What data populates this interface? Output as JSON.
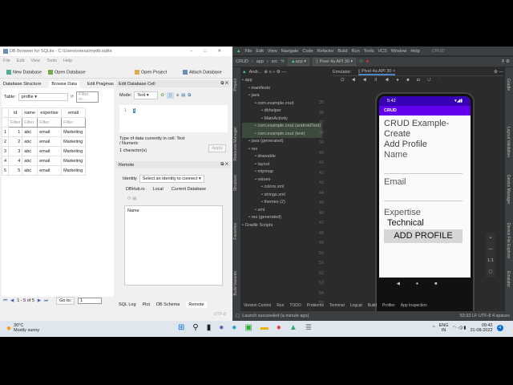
{
  "dbbrowser": {
    "title": "DB Browser for SQLite - C:\\Users\\neesa\\mydb.sqlite",
    "menu": [
      "File",
      "Edit",
      "View",
      "Tools",
      "Help"
    ],
    "toolbar": {
      "new_db": "New Database",
      "open_db": "Open Database",
      "open_project": "Open Project",
      "attach_db": "Attach Database"
    },
    "tabs": [
      "Database Structure",
      "Browse Data",
      "Edit Pragmas"
    ],
    "table_label": "Table:",
    "table_value": "profile",
    "filter_placeholder": "Filter in...",
    "columns": [
      "id",
      "name",
      "expertise",
      "email"
    ],
    "filter": "Filter",
    "rows": [
      {
        "n": "1",
        "id": "1",
        "name": "abc",
        "expertise": "email",
        "email": "Marketing"
      },
      {
        "n": "2",
        "id": "2",
        "name": "abc",
        "expertise": "email",
        "email": "Marketing"
      },
      {
        "n": "3",
        "id": "3",
        "name": "abc",
        "expertise": "email",
        "email": "Marketing"
      },
      {
        "n": "4",
        "id": "4",
        "name": "abc",
        "expertise": "email",
        "email": "Marketing"
      },
      {
        "n": "5",
        "id": "5",
        "name": "abc",
        "expertise": "email",
        "email": "Marketing"
      }
    ],
    "pager": "1 - 5 of 5",
    "goto": "Go to:",
    "goto_value": "1",
    "edit_cell": {
      "title": "Edit Database Cell",
      "mode_label": "Mode:",
      "mode": "Text",
      "line": "1",
      "type_info": "Type of data currently in cell: Text / Numeric",
      "chars": "1 character(s)",
      "apply": "Apply"
    },
    "remote": {
      "title": "Remote",
      "identity_label": "Identity",
      "identity": "Select an identity to connect",
      "tabs": [
        "DBHub.io",
        "Local",
        "Current Database"
      ],
      "col": "Name"
    },
    "bottom_tabs": [
      "SQL Log",
      "Plot",
      "DB Schema",
      "Remote"
    ],
    "encoding": "UTF-8"
  },
  "studio": {
    "menu": [
      "File",
      "Edit",
      "View",
      "Navigate",
      "Code",
      "Refactor",
      "Build",
      "Run",
      "Tools",
      "VCS",
      "Window",
      "Help"
    ],
    "project_title": "CRUD",
    "breadcrumb": [
      "CRUD",
      "app",
      "src"
    ],
    "run_config": "app",
    "device": "Pixel 4a API 30",
    "project_view": "Andr...",
    "emulator_label": "Emulator:",
    "emulator_tab": "Pixel 4a API 30",
    "tree": [
      {
        "label": "app",
        "indent": 0
      },
      {
        "label": "manifests",
        "indent": 1
      },
      {
        "label": "java",
        "indent": 1
      },
      {
        "label": "com.example.crud",
        "indent": 2
      },
      {
        "label": "dbhelper",
        "indent": 3
      },
      {
        "label": "MainActivity",
        "indent": 3
      },
      {
        "label": "com.example.crud (androidTest)",
        "indent": 2
      },
      {
        "label": "com.example.crud (test)",
        "indent": 2
      },
      {
        "label": "java (generated)",
        "indent": 1
      },
      {
        "label": "res",
        "indent": 1
      },
      {
        "label": "drawable",
        "indent": 2
      },
      {
        "label": "layout",
        "indent": 2
      },
      {
        "label": "mipmap",
        "indent": 2
      },
      {
        "label": "values",
        "indent": 2
      },
      {
        "label": "colors.xml",
        "indent": 3
      },
      {
        "label": "strings.xml",
        "indent": 3
      },
      {
        "label": "themes (2)",
        "indent": 3
      },
      {
        "label": "xml",
        "indent": 2
      },
      {
        "label": "res (generated)",
        "indent": 1
      },
      {
        "label": "Gradle Scripts",
        "indent": 0
      }
    ],
    "line_numbers": [
      "35",
      "36",
      "37",
      "38",
      "39",
      "40",
      "41",
      "42",
      "43",
      "44",
      "45",
      "46",
      "47",
      "48",
      "49",
      "50",
      "51",
      "52",
      "53",
      "54",
      "55",
      "56",
      "57"
    ],
    "left_tabs": [
      "Project",
      "Resource Manager",
      "Structure",
      "Favorites",
      "Build Variants"
    ],
    "right_tabs": [
      "Gradle",
      "Layout Validation",
      "Device Manager",
      "Device File Explorer",
      "Emulator"
    ],
    "bottom_tabs": [
      "Version Control",
      "Run",
      "TODO",
      "Problems",
      "Terminal",
      "Logcat",
      "Build",
      "Profiler",
      "App Inspection"
    ],
    "status": "Launch succeeded (a minute ago)",
    "status_right": "53:32  LF  UTF-8  4 spaces",
    "phone": {
      "time": "5:42",
      "appbar": "CRUD",
      "heading": "CRUD Example-Create",
      "sub": "Add Profile",
      "name_hint": "Name",
      "email_hint": "Email",
      "expertise_label": "Expertise",
      "expertise_value": "Technical",
      "button": "ADD PROFILE"
    }
  },
  "taskbar": {
    "temp": "30°C",
    "weather": "Mostly sunny",
    "lang": "ENG",
    "region": "IN",
    "time": "09:42",
    "date": "31-08-2022",
    "notif": "4"
  }
}
